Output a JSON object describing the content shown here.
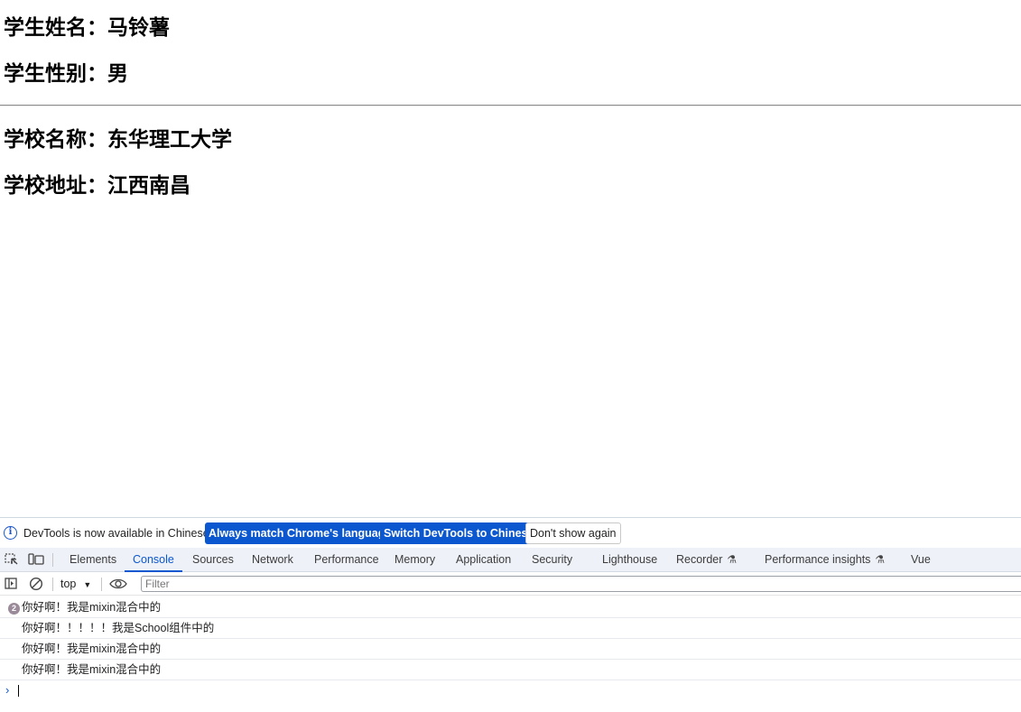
{
  "page": {
    "student_name": "学生姓名：马铃薯",
    "student_gender": "学生性别：男",
    "school_name": "学校名称：东华理工大学",
    "school_address": "学校地址：江西南昌"
  },
  "devtools": {
    "infobar": {
      "message": "DevTools is now available in Chinese!",
      "btn_match": "Always match Chrome's language",
      "btn_switch": "Switch DevTools to Chinese",
      "btn_dismiss": "Don't show again"
    },
    "tabs": [
      "Elements",
      "Console",
      "Sources",
      "Network",
      "Performance",
      "Memory",
      "Application",
      "Security",
      "Lighthouse",
      "Recorder",
      "Performance insights",
      "Vue"
    ],
    "active_tab": "Console",
    "toolbar": {
      "context": "top",
      "filter_placeholder": "Filter"
    },
    "messages": [
      {
        "count": "2",
        "text": "你好啊！我是mixin混合中的"
      },
      {
        "text": "你好啊！！！！！我是School组件中的"
      },
      {
        "text": "你好啊！我是mixin混合中的"
      },
      {
        "text": "你好啊！我是mixin混合中的"
      }
    ],
    "prompt_symbol": "›"
  },
  "colors": {
    "accent": "#0b57d0",
    "tabbar_bg": "#eef1f7",
    "badge": "#9b8a99"
  }
}
